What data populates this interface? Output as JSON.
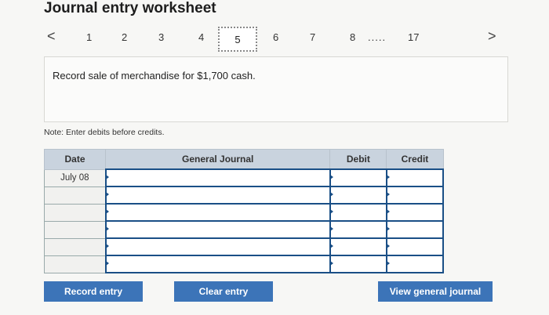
{
  "title": "Journal entry worksheet",
  "pager": {
    "prev": "<",
    "next": ">",
    "items": [
      "1",
      "2",
      "3",
      "4",
      "5",
      "6",
      "7",
      "8",
      ".....",
      "17"
    ],
    "current": "5"
  },
  "instruction": "Record sale of merchandise for $1,700 cash.",
  "note": "Note: Enter debits before credits.",
  "table": {
    "headers": [
      "Date",
      "General Journal",
      "Debit",
      "Credit"
    ],
    "rows": [
      {
        "date": "July 08",
        "account": "",
        "debit": "",
        "credit": ""
      },
      {
        "date": "",
        "account": "",
        "debit": "",
        "credit": ""
      },
      {
        "date": "",
        "account": "",
        "debit": "",
        "credit": ""
      },
      {
        "date": "",
        "account": "",
        "debit": "",
        "credit": ""
      },
      {
        "date": "",
        "account": "",
        "debit": "",
        "credit": ""
      },
      {
        "date": "",
        "account": "",
        "debit": "",
        "credit": ""
      }
    ]
  },
  "buttons": {
    "record": "Record entry",
    "clear": "Clear entry",
    "view": "View general journal"
  },
  "colors": {
    "button": "#3c74b8",
    "header": "#c9d3de",
    "field_border": "#1a4f86"
  }
}
